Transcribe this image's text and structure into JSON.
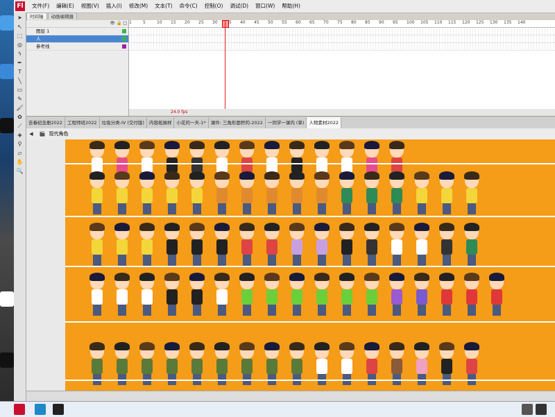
{
  "app": {
    "menu": [
      "文件(F)",
      "编辑(E)",
      "视图(V)",
      "插入(I)",
      "修改(M)",
      "文本(T)",
      "命令(C)",
      "控制(O)",
      "调试(D)",
      "窗口(W)",
      "帮助(H)"
    ]
  },
  "panel_tabs": [
    "时间轴",
    "动画编辑器"
  ],
  "timeline": {
    "layers": [
      {
        "name": "图层 1",
        "color": "#3cb44b",
        "selected": false
      },
      {
        "name": "人",
        "color": "#3cb44b",
        "selected": true
      },
      {
        "name": "参考线",
        "color": "#a020a0",
        "selected": false
      }
    ],
    "ruler": [
      "1",
      "5",
      "10",
      "15",
      "20",
      "25",
      "30",
      "35",
      "40",
      "45",
      "50",
      "55",
      "60",
      "65",
      "70",
      "75",
      "80",
      "85",
      "90",
      "95",
      "100",
      "105",
      "110",
      "115",
      "120",
      "125",
      "130",
      "135",
      "140"
    ],
    "status_fps": "24.0 fps"
  },
  "library_tabs": [
    "吉春纪念册2022",
    "工程师班2022",
    "垃圾分类-IV (交付版)",
    "内容拓展样",
    "小花的一天-1*",
    "课件: 三角形面积的-2022",
    "一同学一课内 (草)",
    "人物素材2022"
  ],
  "active_library_tab": 7,
  "breadcrumb": {
    "scene": "现代角色"
  },
  "canvas": {
    "background": "#f59c18",
    "rows": 5
  },
  "character_rows": [
    {
      "outfits": [
        "#ffffff",
        "#e84c8a",
        "#ffffff",
        "#222222",
        "#333333",
        "#ffffff",
        "#d44",
        "#ffffff",
        "#222",
        "#ffffff",
        "#ffffff",
        "#e84c8a",
        "#d44"
      ]
    },
    {
      "outfits": [
        "#f2d63a",
        "#f2d63a",
        "#f2d63a",
        "#f2d63a",
        "#f2d63a",
        "#e08a30",
        "#e08a30",
        "#e08a30",
        "#e08a30",
        "#e08a30",
        "#2e8b57",
        "#2e8b57",
        "#2e8b57",
        "#f2d63a",
        "#f2d63a",
        "#f2d63a"
      ]
    },
    {
      "outfits": [
        "#f2d63a",
        "#f2d63a",
        "#f2d63a",
        "#222222",
        "#222222",
        "#222222",
        "#d44",
        "#d44",
        "#c8a0e0",
        "#c8a0e0",
        "#222",
        "#333",
        "#fff",
        "#fff",
        "#333",
        "#2e8b57"
      ]
    },
    {
      "outfits": [
        "#ffffff",
        "#ffffff",
        "#ffffff",
        "#222",
        "#222",
        "#ffffff",
        "#6ccf3a",
        "#6ccf3a",
        "#6ccf3a",
        "#6ccf3a",
        "#6ccf3a",
        "#6ccf3a",
        "#9a5ad0",
        "#7a5ad0",
        "#e03838",
        "#e03838",
        "#e03838"
      ]
    },
    {
      "outfits": [
        "#5a7a3a",
        "#5a7a3a",
        "#5a7a3a",
        "#5a7a3a",
        "#5a7a3a",
        "#5a7a3a",
        "#5a7a3a",
        "#5a7a3a",
        "#5a7a3a",
        "#ffffff",
        "#ffffff",
        "#d44",
        "#8a5a3a",
        "#f0a0c0",
        "#222",
        "#d44"
      ]
    }
  ]
}
